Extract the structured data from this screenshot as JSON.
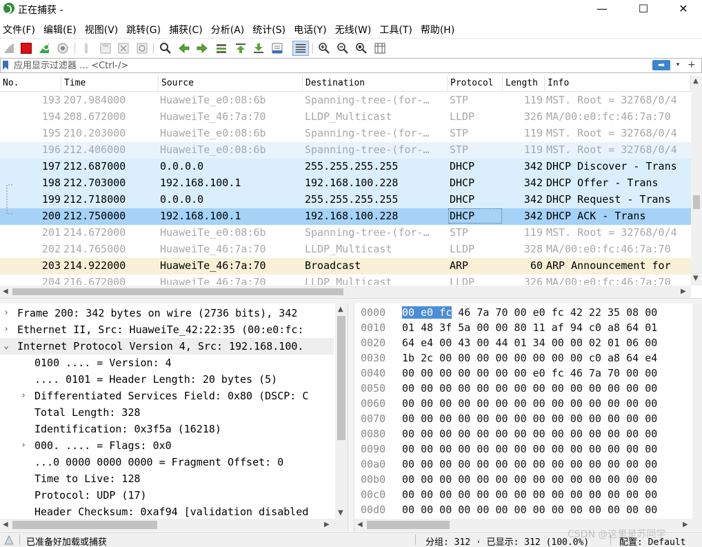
{
  "window": {
    "title": "正在捕获 -",
    "minimize_glyph": "—",
    "maximize_glyph": "☐",
    "close_glyph": "✕"
  },
  "menu": [
    "文件(F)",
    "编辑(E)",
    "视图(V)",
    "跳转(G)",
    "捕获(C)",
    "分析(A)",
    "统计(S)",
    "电话(Y)",
    "无线(W)",
    "工具(T)",
    "帮助(H)"
  ],
  "toolbar_icons": [
    "shark-fin-start-icon",
    "stop-capture-icon",
    "restart-capture-icon",
    "capture-options-icon",
    "open-file-icon",
    "save-file-icon",
    "close-file-icon",
    "reload-file-icon",
    "find-packet-icon",
    "go-back-icon",
    "go-forward-icon",
    "go-to-packet-icon",
    "go-first-icon",
    "go-last-icon",
    "auto-scroll-icon",
    "colorize-icon",
    "zoom-in-icon",
    "zoom-out-icon",
    "zoom-normal-icon",
    "resize-columns-icon"
  ],
  "filter": {
    "placeholder": "应用显示过滤器 … <Ctrl-/>",
    "apply_glyph": "➡",
    "dropdown_glyph": "▾",
    "add_glyph": "+"
  },
  "packet_list": {
    "columns": [
      "No.",
      "Time",
      "Source",
      "Destination",
      "Protocol",
      "Length",
      "Info"
    ],
    "rows": [
      {
        "no": "193",
        "time": "207.984000",
        "source": "HuaweiTe_e0:08:6b",
        "destination": "Spanning-tree-(for-…",
        "protocol": "STP",
        "length": "119",
        "info": "MST. Root = 32768/0/4"
      },
      {
        "no": "194",
        "time": "208.672000",
        "source": "HuaweiTe_46:7a:70",
        "destination": "LLDP_Multicast",
        "protocol": "LLDP",
        "length": "326",
        "info": "MA/00:e0:fc:46:7a:70"
      },
      {
        "no": "195",
        "time": "210.203000",
        "source": "HuaweiTe_e0:08:6b",
        "destination": "Spanning-tree-(for-…",
        "protocol": "STP",
        "length": "119",
        "info": "MST. Root = 32768/0/4"
      },
      {
        "no": "196",
        "time": "212.406000",
        "source": "HuaweiTe_e0:08:6b",
        "destination": "Spanning-tree-(for-…",
        "protocol": "STP",
        "length": "119",
        "info": "MST. Root = 32768/0/4"
      },
      {
        "no": "197",
        "time": "212.687000",
        "source": "0.0.0.0",
        "destination": "255.255.255.255",
        "protocol": "DHCP",
        "length": "342",
        "info": "DHCP Discover - Trans"
      },
      {
        "no": "198",
        "time": "212.703000",
        "source": "192.168.100.1",
        "destination": "192.168.100.228",
        "protocol": "DHCP",
        "length": "342",
        "info": "DHCP Offer    - Trans"
      },
      {
        "no": "199",
        "time": "212.718000",
        "source": "0.0.0.0",
        "destination": "255.255.255.255",
        "protocol": "DHCP",
        "length": "342",
        "info": "DHCP Request  - Trans"
      },
      {
        "no": "200",
        "time": "212.750000",
        "source": "192.168.100.1",
        "destination": "192.168.100.228",
        "protocol": "DHCP",
        "length": "342",
        "info": "DHCP ACK      - Trans"
      },
      {
        "no": "201",
        "time": "214.672000",
        "source": "HuaweiTe_e0:08:6b",
        "destination": "Spanning-tree-(for-…",
        "protocol": "STP",
        "length": "119",
        "info": "MST. Root = 32768/0/4"
      },
      {
        "no": "202",
        "time": "214.765000",
        "source": "HuaweiTe_46:7a:70",
        "destination": "LLDP_Multicast",
        "protocol": "LLDP",
        "length": "328",
        "info": "MA/00:e0:fc:46:7a:70"
      },
      {
        "no": "203",
        "time": "214.922000",
        "source": "HuaweiTe_46:7a:70",
        "destination": "Broadcast",
        "protocol": "ARP",
        "length": "60",
        "info": "ARP Announcement for"
      },
      {
        "no": "204",
        "time": "216.672000",
        "source": "HuaweiTe_46:7a:70",
        "destination": "LLDP_Multicast",
        "protocol": "LLDP",
        "length": "326",
        "info": "MA/00:e0:fc:46:7a:70"
      }
    ]
  },
  "details": [
    {
      "twisty": "›",
      "text": "Frame 200: 342 bytes on wire (2736 bits), 342"
    },
    {
      "twisty": "›",
      "text": "Ethernet II, Src: HuaweiTe_42:22:35 (00:e0:fc:"
    },
    {
      "twisty": "⌄",
      "text": "Internet Protocol Version 4, Src: 192.168.100."
    },
    {
      "twisty": "",
      "text": "0100 .... = Version: 4"
    },
    {
      "twisty": "",
      "text": ".... 0101 = Header Length: 20 bytes (5)"
    },
    {
      "twisty": "›",
      "text": "Differentiated Services Field: 0x80 (DSCP: C"
    },
    {
      "twisty": "",
      "text": "Total Length: 328"
    },
    {
      "twisty": "",
      "text": "Identification: 0x3f5a (16218)"
    },
    {
      "twisty": "›",
      "text": "000. .... = Flags: 0x0"
    },
    {
      "twisty": "",
      "text": "...0 0000 0000 0000 = Fragment Offset: 0"
    },
    {
      "twisty": "",
      "text": "Time to Live: 128"
    },
    {
      "twisty": "",
      "text": "Protocol: UDP (17)"
    },
    {
      "twisty": "",
      "text": "Header Checksum: 0xaf94 [validation disabled"
    }
  ],
  "bytes": {
    "selected": "00 e0 fc",
    "rows": [
      {
        "offset": "0000",
        "hex": " 46 7a 70 00 e0  fc 42 22 35 08 00"
      },
      {
        "offset": "0010",
        "hex": "01 48 3f 5a 00 00 80 11  af 94 c0 a8 64 01"
      },
      {
        "offset": "0020",
        "hex": "64 e4 00 43 00 44 01 34  00 00 02 01 06 00"
      },
      {
        "offset": "0030",
        "hex": "1b 2c 00 00 00 00 00 00  00 00 c0 a8 64 e4"
      },
      {
        "offset": "0040",
        "hex": "00 00 00 00 00 00 00 e0  fc 46 7a 70 00 00"
      },
      {
        "offset": "0050",
        "hex": "00 00 00 00 00 00 00 00  00 00 00 00 00 00"
      },
      {
        "offset": "0060",
        "hex": "00 00 00 00 00 00 00 00  00 00 00 00 00 00"
      },
      {
        "offset": "0070",
        "hex": "00 00 00 00 00 00 00 00  00 00 00 00 00 00"
      },
      {
        "offset": "0080",
        "hex": "00 00 00 00 00 00 00 00  00 00 00 00 00 00"
      },
      {
        "offset": "0090",
        "hex": "00 00 00 00 00 00 00 00  00 00 00 00 00 00"
      },
      {
        "offset": "00a0",
        "hex": "00 00 00 00 00 00 00 00  00 00 00 00 00 00"
      },
      {
        "offset": "00b0",
        "hex": "00 00 00 00 00 00 00 00  00 00 00 00 00 00"
      },
      {
        "offset": "00c0",
        "hex": "00 00 00 00 00 00 00 00  00 00 00 00 00 00"
      },
      {
        "offset": "00d0",
        "hex": "00 00 00 00 00 00 00 00  00 00 00 00 00 00"
      }
    ]
  },
  "status": {
    "ready": "已准备好加载或捕获",
    "stats": "分组: 312 · 已显示: 312 (100.0%)",
    "profile": "配置: Default"
  },
  "watermark": "CSDN @这里是苏同学",
  "colors": {
    "selected_row": "#a6d2f7",
    "dhcp_row": "#daeefc",
    "arp_row": "#faf0d7",
    "byte_highlight": "#4b8ed8",
    "stop_red": "#dd1111"
  }
}
